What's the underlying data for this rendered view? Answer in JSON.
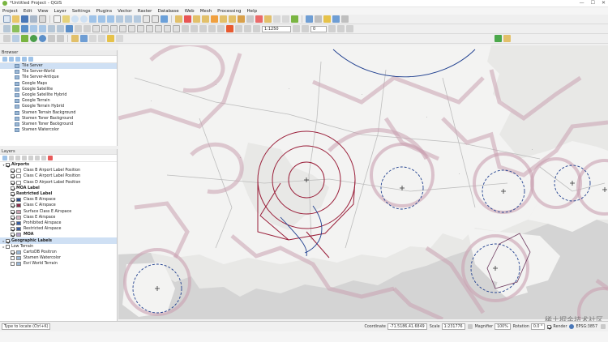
{
  "window": {
    "title": "*Untitled Project - QGIS"
  },
  "menu": [
    "Project",
    "Edit",
    "View",
    "Layer",
    "Settings",
    "Plugins",
    "Vector",
    "Raster",
    "Database",
    "Web",
    "Mesh",
    "Processing",
    "Help"
  ],
  "toolbar": {
    "zoom_value": "1:1250",
    "scale_value": "0"
  },
  "browser": {
    "header": "Browser",
    "items": [
      {
        "label": "Tile Server"
      },
      {
        "label": "Tile Server-World"
      },
      {
        "label": "Tile Server-Antique"
      },
      {
        "label": "Google Maps"
      },
      {
        "label": "Google Satellite"
      },
      {
        "label": "Google Satellite Hybrid"
      },
      {
        "label": "Google Terrain"
      },
      {
        "label": "Google Terrain Hybrid"
      },
      {
        "label": "Stamen Terrain Background"
      },
      {
        "label": "Stamen Toner Background"
      },
      {
        "label": "Stamen Toner Background"
      },
      {
        "label": "Stamen Watercolor"
      }
    ]
  },
  "layers": {
    "header": "Layers",
    "items": [
      {
        "label": "Airports",
        "checked": true,
        "expander": "▾",
        "bold": true,
        "symbol": "none"
      },
      {
        "label": "Class B Airport Label Position",
        "checked": true,
        "expander": "",
        "bold": false,
        "symbol": "#ffffff"
      },
      {
        "label": "Class C Airport Label Position",
        "checked": true,
        "expander": "",
        "bold": false,
        "symbol": "#ffffff"
      },
      {
        "label": "Class D Airport Label Position",
        "checked": true,
        "expander": "",
        "bold": false,
        "symbol": "#ffffff"
      },
      {
        "label": "MOA Label",
        "checked": true,
        "expander": "",
        "bold": true,
        "symbol": "none"
      },
      {
        "label": "Restricted Label",
        "checked": true,
        "expander": "",
        "bold": true,
        "symbol": "none"
      },
      {
        "label": "Class B Airspace",
        "checked": true,
        "expander": "",
        "bold": false,
        "symbol": "#2f4f8f"
      },
      {
        "label": "Class C Airspace",
        "checked": true,
        "expander": "",
        "bold": false,
        "symbol": "#8a2b4a"
      },
      {
        "label": "Surface Class E Airspace",
        "checked": true,
        "expander": "",
        "bold": false,
        "symbol": "#c9a0b0"
      },
      {
        "label": "Class E Airspace",
        "checked": true,
        "expander": "",
        "bold": false,
        "symbol": "#d8b7c3"
      },
      {
        "label": "Prohibited Airspace",
        "checked": true,
        "expander": "",
        "bold": false,
        "symbol": "#3a5fa0"
      },
      {
        "label": "Restricted Airspace",
        "checked": true,
        "expander": "",
        "bold": false,
        "symbol": "#3a5fa0"
      },
      {
        "label": "MOA",
        "checked": true,
        "expander": "",
        "bold": true,
        "symbol": "#b5a0c8"
      },
      {
        "label": "Geographic Labels",
        "checked": true,
        "expander": "▸",
        "bold": true,
        "symbol": "none",
        "highlight": true
      },
      {
        "label": "Low Terrain",
        "checked": false,
        "expander": "▸",
        "bold": false,
        "symbol": "none"
      },
      {
        "label": "CartoDB Positron",
        "checked": true,
        "expander": "",
        "bold": false,
        "symbol": "#9bb7d4"
      },
      {
        "label": "Stamen Watercolor",
        "checked": false,
        "expander": "",
        "bold": false,
        "symbol": "#9bb7d4"
      },
      {
        "label": "Esri World Terrain",
        "checked": false,
        "expander": "",
        "bold": false,
        "symbol": "#9bb7d4"
      }
    ]
  },
  "status": {
    "locator_placeholder": "Type to locate (Ctrl+K)",
    "coordinate_label": "Coordinate",
    "coordinate_value": "-71.5186,41.6849",
    "scale_label": "Scale",
    "scale_value": "1:231776",
    "magnifier_label": "Magnifier",
    "magnifier_value": "100%",
    "rotation_label": "Rotation",
    "rotation_value": "0.0 °",
    "render_label": "Render",
    "crs_value": "EPSG:3857"
  },
  "watermark": "稀土掘金技术社区",
  "colors": {
    "accent": "#7ab542",
    "airspace_red": "#9a1f3a",
    "airspace_blue": "#1f3f8f",
    "halo": "#c9a0b0"
  }
}
